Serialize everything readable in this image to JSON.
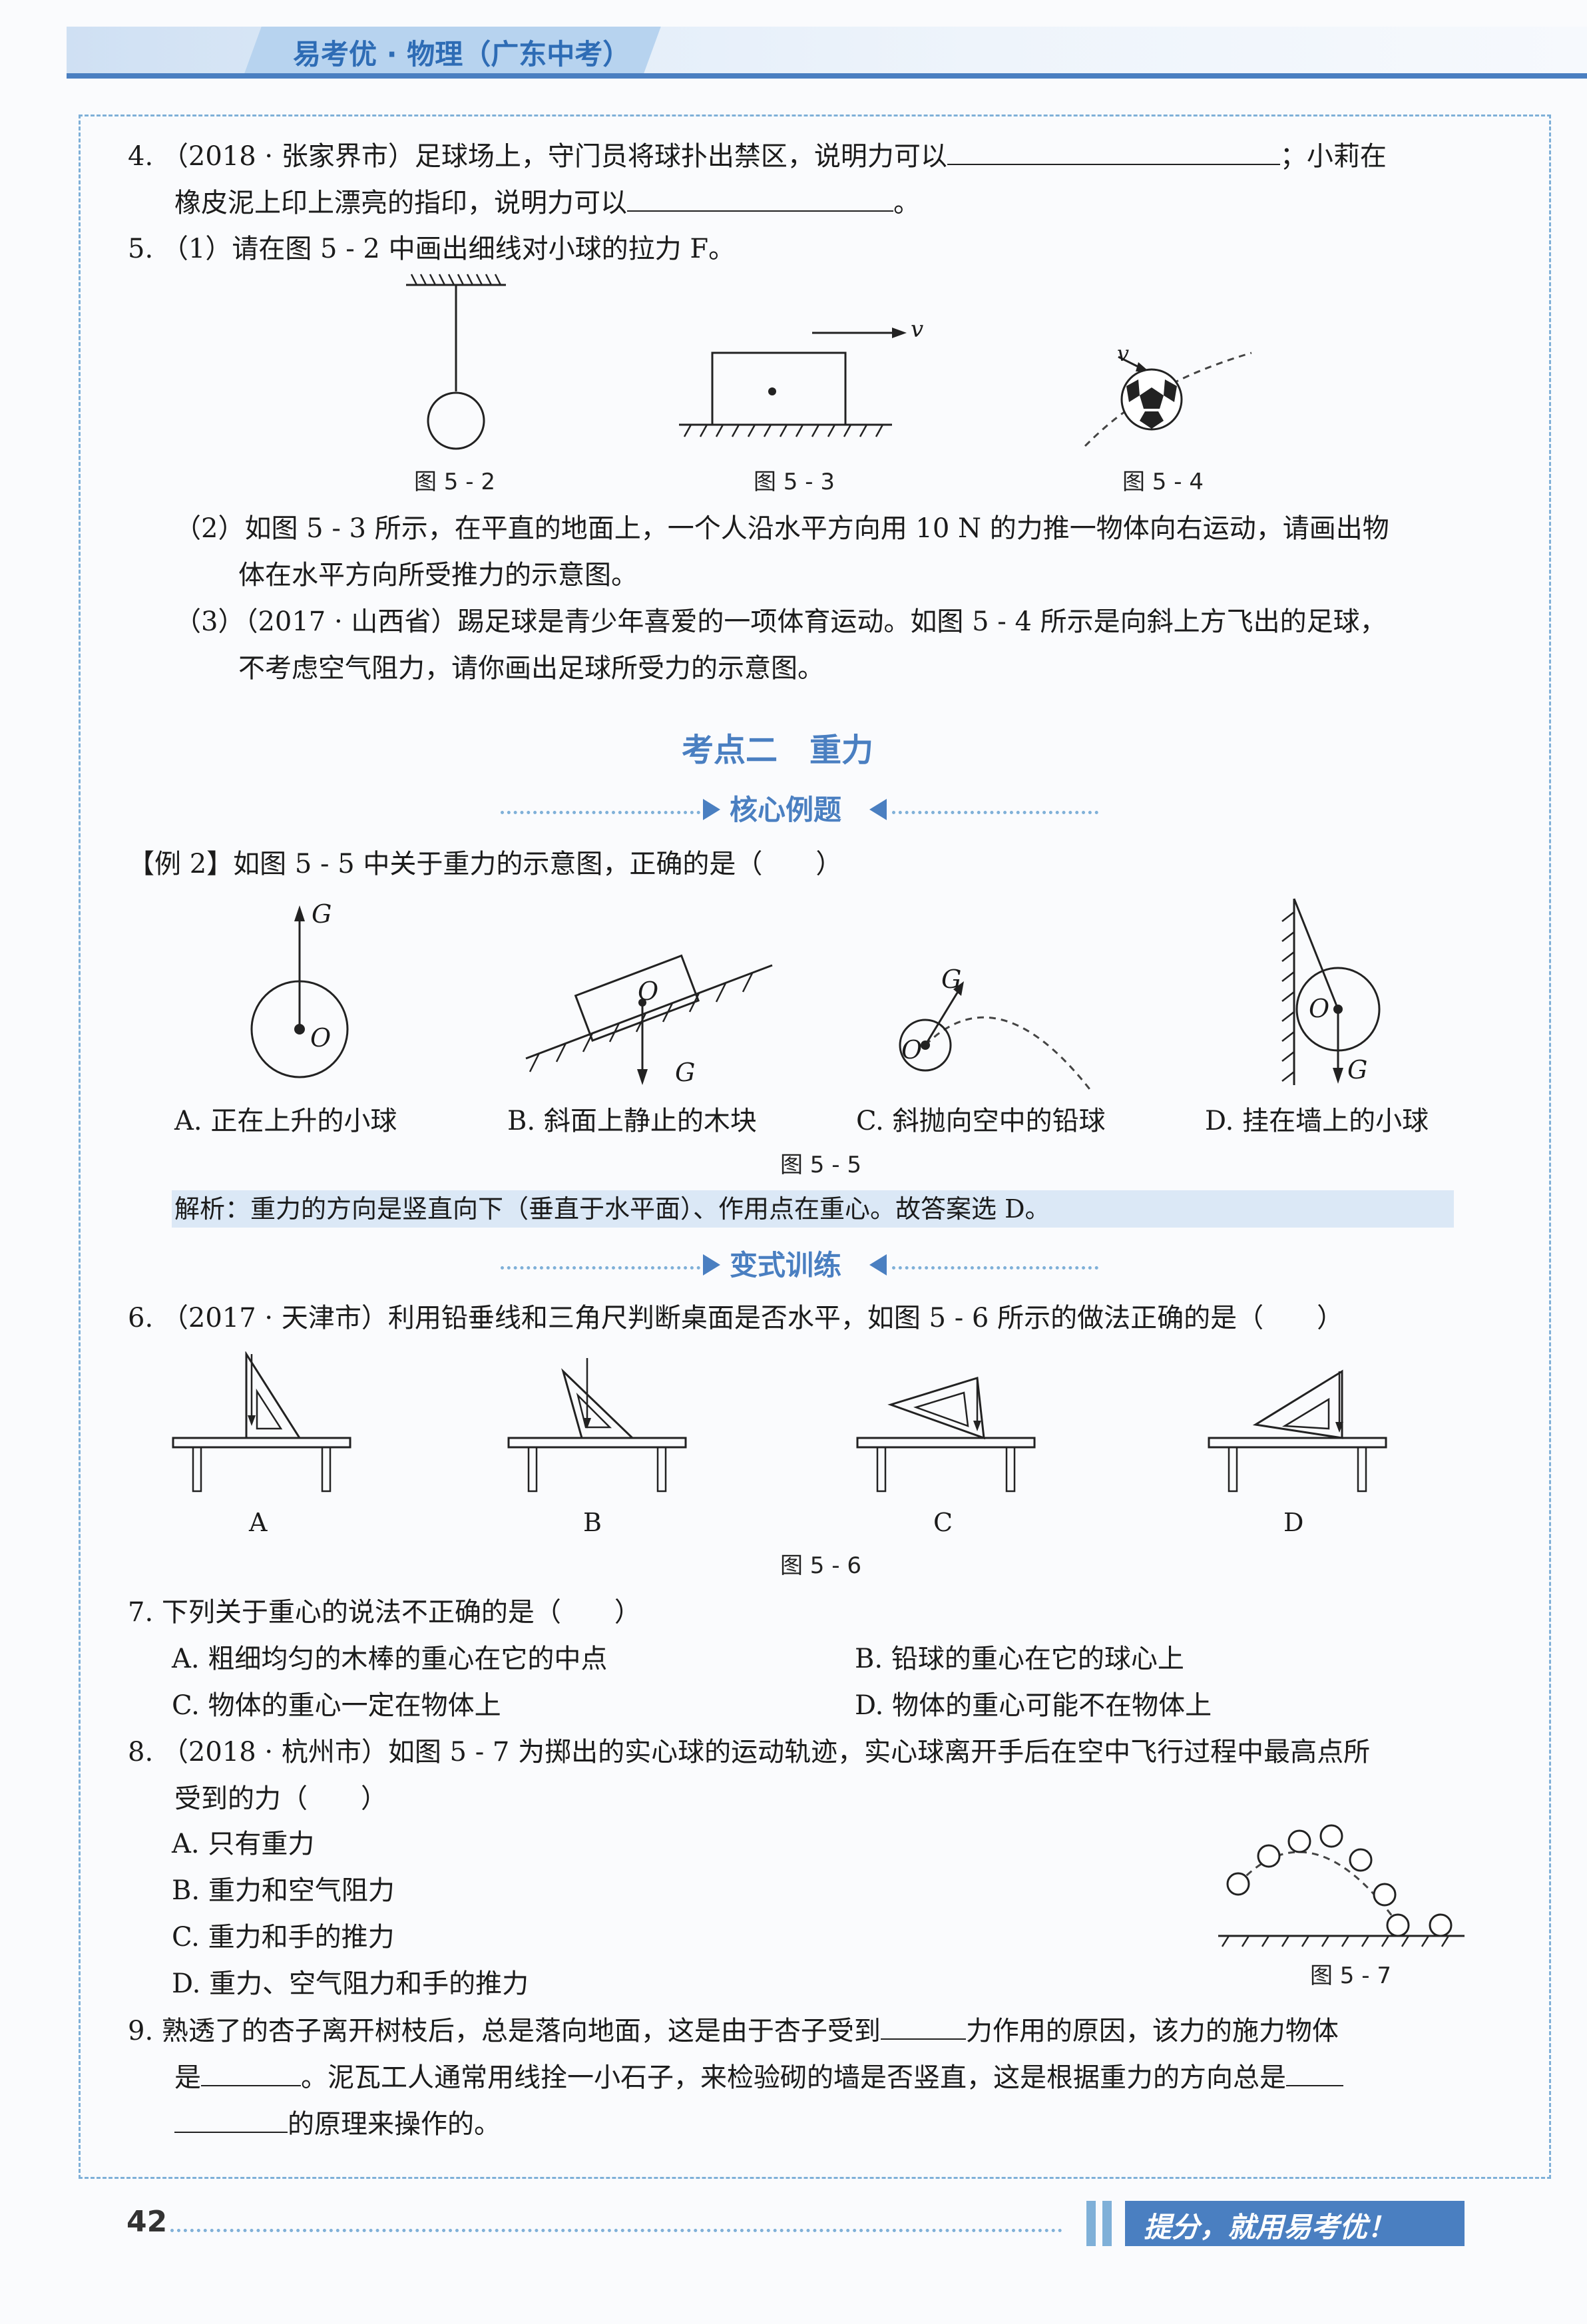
{
  "header": {
    "title": "易考优 · 物理（广东中考）"
  },
  "q4": {
    "text_a": "4. （2018 · 张家界市）足球场上，守门员将球扑出禁区，说明力可以",
    "text_b": "；小莉在",
    "text_c": "橡皮泥上印上漂亮的指印，说明力可以",
    "text_d": "。"
  },
  "q5": {
    "part1": "5. （1）请在图 5 - 2 中画出细线对小球的拉力 F。",
    "fig2": "图 5 - 2",
    "fig3": "图 5 - 3",
    "fig4": "图 5 - 4",
    "fig3_v": "v",
    "fig4_v": "v",
    "part2_a": "（2）如图 5 - 3 所示，在平直的地面上，一个人沿水平方向用 10 N 的力推一物体向右运动，请画出物",
    "part2_b": "体在水平方向所受推力的示意图。",
    "part3_a": "（3）（2017 · 山西省）踢足球是青少年喜爱的一项体育运动。如图 5 - 4 所示是向斜上方飞出的足球，",
    "part3_b": "不考虑空气阻力，请你画出足球所受力的示意图。"
  },
  "section2": {
    "title": "考点二　重力",
    "core": "核心例题",
    "variant": "变式训练"
  },
  "example2": {
    "question": "【例 2】如图 5 - 5 中关于重力的示意图，正确的是（　　）",
    "g": "G",
    "o": "O",
    "option_a": "A. 正在上升的小球",
    "option_b": "B. 斜面上静止的木块",
    "option_c": "C. 斜抛向空中的铅球",
    "option_d": "D. 挂在墙上的小球",
    "fig": "图 5 - 5",
    "analysis": "解析：重力的方向是竖直向下（垂直于水平面）、作用点在重心。故答案选 D。"
  },
  "q6": {
    "question": "6. （2017 · 天津市）利用铅垂线和三角尺判断桌面是否水平，如图 5 - 6 所示的做法正确的是（　　）",
    "labels": [
      "A",
      "B",
      "C",
      "D"
    ],
    "fig": "图 5 - 6"
  },
  "q7": {
    "question": "7. 下列关于重心的说法不正确的是（　　）",
    "option_a": "A. 粗细均匀的木棒的重心在它的中点",
    "option_b": "B. 铅球的重心在它的球心上",
    "option_c": "C. 物体的重心一定在物体上",
    "option_d": "D. 物体的重心可能不在物体上"
  },
  "q8": {
    "question_a": "8. （2018 · 杭州市）如图 5 - 7 为掷出的实心球的运动轨迹，实心球离开手后在空中飞行过程中最高点所",
    "question_b": "受到的力（　　）",
    "option_a": "A. 只有重力",
    "option_b": "B. 重力和空气阻力",
    "option_c": "C. 重力和手的推力",
    "option_d": "D. 重力、空气阻力和手的推力",
    "fig": "图 5 - 7"
  },
  "q9": {
    "text_a1": "9. 熟透了的杏子离开树枝后，总是落向地面，这是由于杏子受到",
    "text_a2": "力作用的原因，该力的施力物体",
    "text_b1": "是",
    "text_b2": "。泥瓦工人通常用线拴一小石子，来检验砌的墙是否竖直，这是根据重力的方向总是",
    "text_c": "的原理来操作的。"
  },
  "footer": {
    "page_number": "42",
    "slogan": "提分，就用易考优！"
  },
  "colors": {
    "accent": "#4a7fc1",
    "band": "#cfe0f3",
    "dash": "#7fb0d8"
  }
}
